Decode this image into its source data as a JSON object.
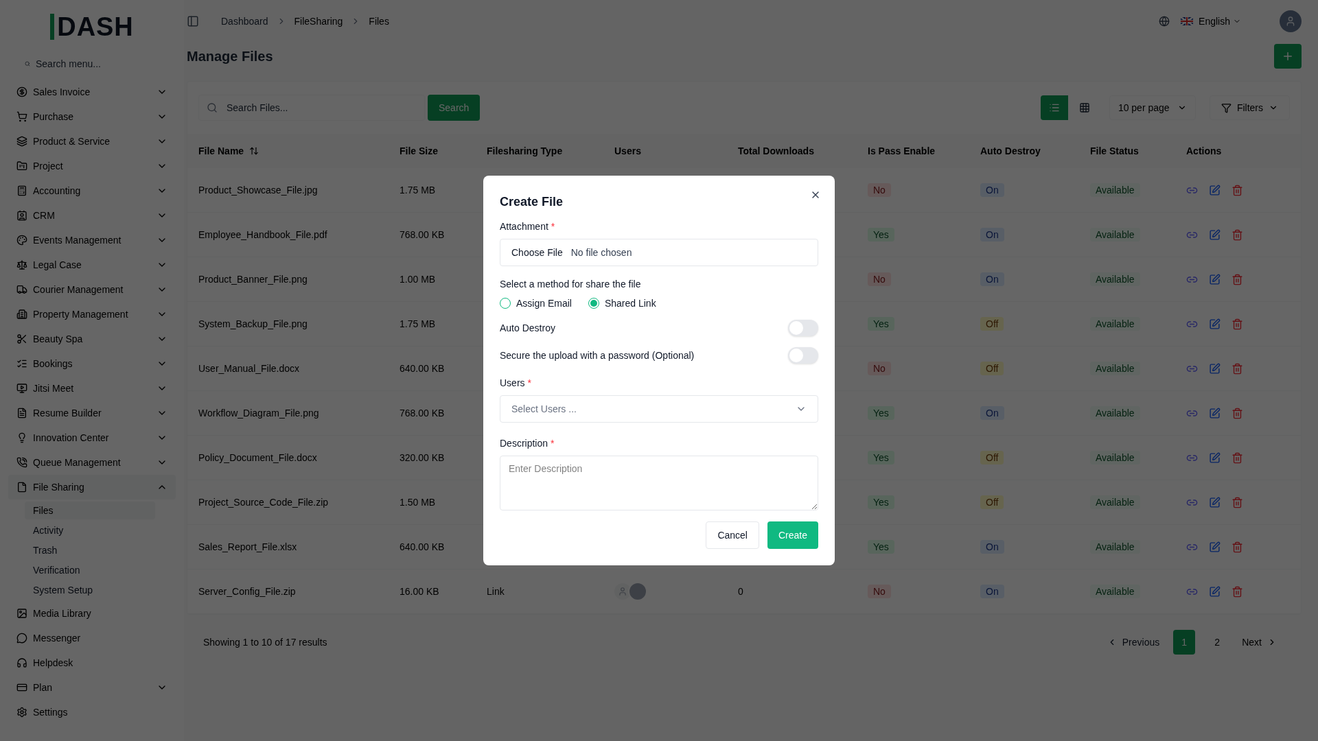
{
  "logo": "DASH",
  "sidebar": {
    "search_placeholder": "Search menu...",
    "items": [
      {
        "label": "Sales Invoice",
        "expandable": true,
        "expanded": false
      },
      {
        "label": "Purchase",
        "expandable": true,
        "expanded": false
      },
      {
        "label": "Product & Service",
        "expandable": true,
        "expanded": false
      },
      {
        "label": "Project",
        "expandable": true,
        "expanded": false
      },
      {
        "label": "Accounting",
        "expandable": true,
        "expanded": false
      },
      {
        "label": "CRM",
        "expandable": true,
        "expanded": false
      },
      {
        "label": "Events Management",
        "expandable": true,
        "expanded": false
      },
      {
        "label": "Legal Case",
        "expandable": true,
        "expanded": false
      },
      {
        "label": "Courier Management",
        "expandable": true,
        "expanded": false
      },
      {
        "label": "Property Management",
        "expandable": true,
        "expanded": false
      },
      {
        "label": "Beauty Spa",
        "expandable": true,
        "expanded": false
      },
      {
        "label": "Bookings",
        "expandable": true,
        "expanded": false
      },
      {
        "label": "Jitsi Meet",
        "expandable": true,
        "expanded": false
      },
      {
        "label": "Resume Builder",
        "expandable": true,
        "expanded": false
      },
      {
        "label": "Innovation Center",
        "expandable": true,
        "expanded": false
      },
      {
        "label": "Queue Management",
        "expandable": true,
        "expanded": false
      },
      {
        "label": "File Sharing",
        "expandable": true,
        "expanded": true,
        "children": [
          {
            "label": "Files",
            "selected": true
          },
          {
            "label": "Activity",
            "selected": false
          },
          {
            "label": "Trash",
            "selected": false
          },
          {
            "label": "Verification",
            "selected": false
          },
          {
            "label": "System Setup",
            "selected": false
          }
        ]
      },
      {
        "label": "Media Library",
        "expandable": false
      },
      {
        "label": "Messenger",
        "expandable": false
      },
      {
        "label": "Helpdesk",
        "expandable": false
      },
      {
        "label": "Plan",
        "expandable": true,
        "expanded": false
      },
      {
        "label": "Settings",
        "expandable": false
      }
    ]
  },
  "breadcrumb": [
    "Dashboard",
    "FileSharing",
    "Files"
  ],
  "language": "English",
  "page_title": "Manage Files",
  "toolbar": {
    "search_placeholder": "Search Files...",
    "search_button": "Search",
    "list_view_selected": true,
    "per_page": "10 per page",
    "filters": "Filters"
  },
  "table": {
    "columns": [
      "File Name",
      "File Size",
      "Filesharing Type",
      "Users",
      "Total Downloads",
      "Is Pass Enable",
      "Auto Destroy",
      "File Status",
      "Actions"
    ],
    "rows": [
      {
        "name": "Product_Showcase_File.jpg",
        "size": "1.75 MB",
        "pass": {
          "text": "No",
          "on": false
        },
        "destroy": {
          "text": "On",
          "on": true
        },
        "status": "Available"
      },
      {
        "name": "Employee_Handbook_File.pdf",
        "size": "768.00 KB",
        "pass": {
          "text": "Yes",
          "on": true
        },
        "destroy": {
          "text": "On",
          "on": true
        },
        "status": "Available"
      },
      {
        "name": "Product_Banner_File.png",
        "size": "1.00 MB",
        "pass": {
          "text": "No",
          "on": false
        },
        "destroy": {
          "text": "On",
          "on": true
        },
        "status": "Available"
      },
      {
        "name": "System_Backup_File.png",
        "size": "1.75 MB",
        "pass": {
          "text": "Yes",
          "on": true
        },
        "destroy": {
          "text": "Off",
          "on": false
        },
        "status": "Available"
      },
      {
        "name": "User_Manual_File.docx",
        "size": "640.00 KB",
        "pass": {
          "text": "No",
          "on": false
        },
        "destroy": {
          "text": "Off",
          "on": false
        },
        "status": "Available"
      },
      {
        "name": "Workflow_Diagram_File.png",
        "size": "768.00 KB",
        "pass": {
          "text": "Yes",
          "on": true
        },
        "destroy": {
          "text": "On",
          "on": true
        },
        "status": "Available"
      },
      {
        "name": "Policy_Document_File.docx",
        "size": "320.00 KB",
        "pass": {
          "text": "Yes",
          "on": true
        },
        "destroy": {
          "text": "Off",
          "on": false
        },
        "status": "Available"
      },
      {
        "name": "Project_Source_Code_File.zip",
        "size": "1.50 MB",
        "pass": {
          "text": "Yes",
          "on": true
        },
        "destroy": {
          "text": "Off",
          "on": false
        },
        "status": "Available"
      },
      {
        "name": "Sales_Report_File.xlsx",
        "size": "640.00 KB",
        "pass": {
          "text": "Yes",
          "on": true
        },
        "destroy": {
          "text": "On",
          "on": true
        },
        "status": "Available"
      },
      {
        "name": "Server_Config_File.zip",
        "size": "16.00 KB",
        "type": "Link",
        "users": [
          {
            "kind": "silhouette"
          },
          {
            "kind": "photo"
          }
        ],
        "downloads": "0",
        "pass": {
          "text": "No",
          "on": false
        },
        "destroy": {
          "text": "On",
          "on": true
        },
        "status": "Available"
      }
    ]
  },
  "footer": {
    "summary": "Showing 1 to 10 of 17 results",
    "previous": "Previous",
    "pages": [
      {
        "label": "1",
        "selected": true
      },
      {
        "label": "2",
        "selected": false
      }
    ],
    "next": "Next"
  },
  "modal": {
    "title": "Create File",
    "attachment_label": "Attachment",
    "attachment_required": "*",
    "users_required": "*",
    "description_required": "*",
    "choose_file": "Choose File",
    "no_file": "No file chosen",
    "method_label": "Select a method for share the file",
    "methods": [
      {
        "label": "Assign Email",
        "selected": false
      },
      {
        "label": "Shared Link",
        "selected": true
      }
    ],
    "toggles": [
      {
        "label": "Auto Destroy",
        "on": false
      },
      {
        "label": "Secure the upload with a password (Optional)",
        "on": false
      }
    ],
    "users_label": "Users",
    "users_placeholder": "Select Users ...",
    "description_label": "Description",
    "description_placeholder": "Enter Description",
    "cancel": "Cancel",
    "create": "Create"
  }
}
